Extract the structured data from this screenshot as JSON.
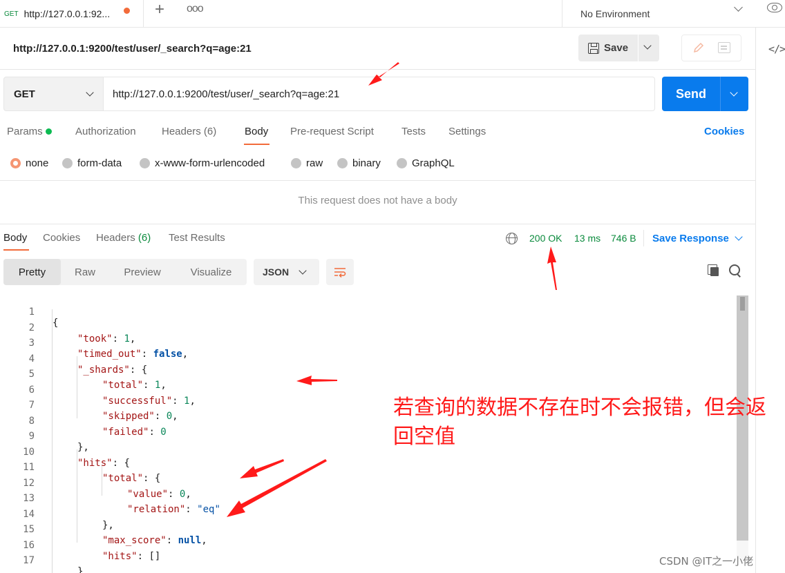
{
  "tab": {
    "method": "GET",
    "name": "http://127.0.0.1:92...",
    "add_icon": "plus-icon",
    "more_icon": "ellipsis-icon"
  },
  "environment": {
    "label": "No Environment"
  },
  "request": {
    "title": "http://127.0.0.1:9200/test/user/_search?q=age:21",
    "method": "GET",
    "url": "http://127.0.0.1:9200/test/user/_search?q=age:21",
    "save_label": "Save",
    "send_label": "Send"
  },
  "request_tabs": {
    "params": "Params",
    "authorization": "Authorization",
    "headers": "Headers",
    "headers_count": "(6)",
    "body": "Body",
    "prerequest": "Pre-request Script",
    "tests": "Tests",
    "settings": "Settings",
    "cookies": "Cookies"
  },
  "body_types": {
    "none": "none",
    "form_data": "form-data",
    "urlencoded": "x-www-form-urlencoded",
    "raw": "raw",
    "binary": "binary",
    "graphql": "GraphQL",
    "selected": "none"
  },
  "no_body_message": "This request does not have a body",
  "response_tabs": {
    "body": "Body",
    "cookies": "Cookies",
    "headers": "Headers",
    "headers_count": "(6)",
    "test_results": "Test Results"
  },
  "response_status": {
    "status": "200 OK",
    "time": "13 ms",
    "size": "746 B",
    "save_response": "Save Response"
  },
  "view_modes": {
    "pretty": "Pretty",
    "raw": "Raw",
    "preview": "Preview",
    "visualize": "Visualize",
    "active": "Pretty"
  },
  "format": "JSON",
  "code_lines": [
    {
      "num": "1",
      "text": "{"
    },
    {
      "num": "2",
      "text": "\"took\": 1,"
    },
    {
      "num": "3",
      "text": "\"timed_out\": false,"
    },
    {
      "num": "4",
      "text": "\"_shards\": {"
    },
    {
      "num": "5",
      "text": "\"total\": 1,"
    },
    {
      "num": "6",
      "text": "\"successful\": 1,"
    },
    {
      "num": "7",
      "text": "\"skipped\": 0,"
    },
    {
      "num": "8",
      "text": "\"failed\": 0"
    },
    {
      "num": "9",
      "text": "},"
    },
    {
      "num": "10",
      "text": "\"hits\": {"
    },
    {
      "num": "11",
      "text": "\"total\": {"
    },
    {
      "num": "12",
      "text": "\"value\": 0,"
    },
    {
      "num": "13",
      "text": "\"relation\": \"eq\""
    },
    {
      "num": "14",
      "text": "},"
    },
    {
      "num": "15",
      "text": "\"max_score\": null,"
    },
    {
      "num": "16",
      "text": "\"hits\": []"
    },
    {
      "num": "17",
      "text": "}"
    }
  ],
  "annotation": {
    "note": "若查询的数据不存在时不会报错，但会返回空值",
    "arrow_color": "#ff1a1a"
  },
  "watermark": "CSDN @IT之一小佬",
  "colors": {
    "accent_orange": "#f26b3a",
    "send_blue": "#097bed",
    "status_green": "#0a8a3c"
  }
}
